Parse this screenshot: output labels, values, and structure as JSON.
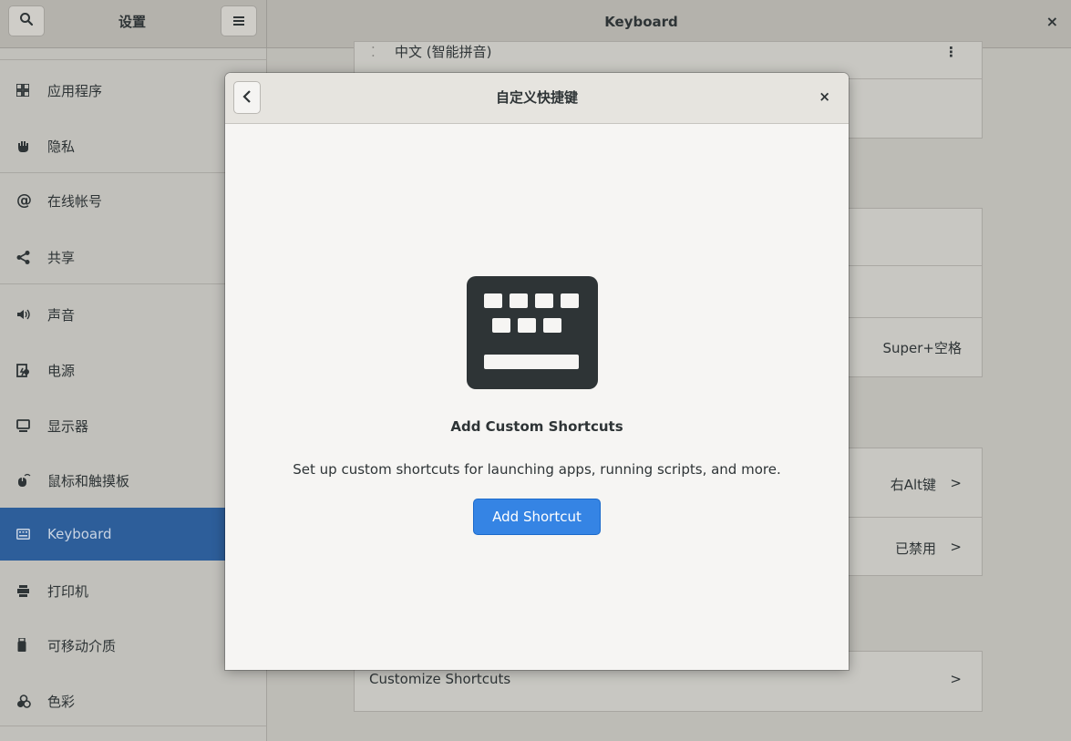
{
  "header": {
    "search_icon_glyph": "🔍",
    "left_title": "设置",
    "menu_icon_glyph": "≡",
    "title": "Keyboard",
    "close_glyph": "×"
  },
  "sidebar": {
    "items": [
      {
        "label": "应用程序",
        "icon": "grid-icon",
        "glyph": "▦"
      },
      {
        "label": "隐私",
        "icon": "hand-icon",
        "glyph": "✋"
      },
      {
        "label": "在线帐号",
        "icon": "at-icon",
        "glyph": "@"
      },
      {
        "label": "共享",
        "icon": "share-icon",
        "glyph": "<"
      },
      {
        "label": "声音",
        "icon": "speaker-icon",
        "glyph": "◀)"
      },
      {
        "label": "电源",
        "icon": "battery-icon",
        "glyph": "▯"
      },
      {
        "label": "显示器",
        "icon": "monitor-icon",
        "glyph": "▭"
      },
      {
        "label": "鼠标和触摸板",
        "icon": "mouse-icon",
        "glyph": "⊕"
      },
      {
        "label": "Keyboard",
        "icon": "keyboard-icon",
        "glyph": "⌨",
        "selected": true
      },
      {
        "label": "打印机",
        "icon": "printer-icon",
        "glyph": "⎙"
      },
      {
        "label": "可移动介质",
        "icon": "usb-drive-icon",
        "glyph": "▮"
      },
      {
        "label": "色彩",
        "icon": "color-icon",
        "glyph": "⁂"
      }
    ]
  },
  "background": {
    "input_source_label": "中文 (智能拼音)",
    "input_source_menu_glyph": "⋮",
    "super_space_value": "Super+空格",
    "right_alt_value": "右Alt键",
    "disabled_value": "已禁用",
    "chevron": ">",
    "customize_shortcuts_label": "Customize Shortcuts"
  },
  "dialog": {
    "back_glyph": "<",
    "title": "自定义快捷键",
    "close_glyph": "×",
    "empty_title": "Add Custom Shortcuts",
    "empty_description": "Set up custom shortcuts for launching apps, running scripts, and more.",
    "add_button_label": "Add Shortcut"
  },
  "colors": {
    "accent": "#3584e4",
    "sidebar_selected": "#2d5e9a",
    "icon_dark": "#2e3436"
  }
}
